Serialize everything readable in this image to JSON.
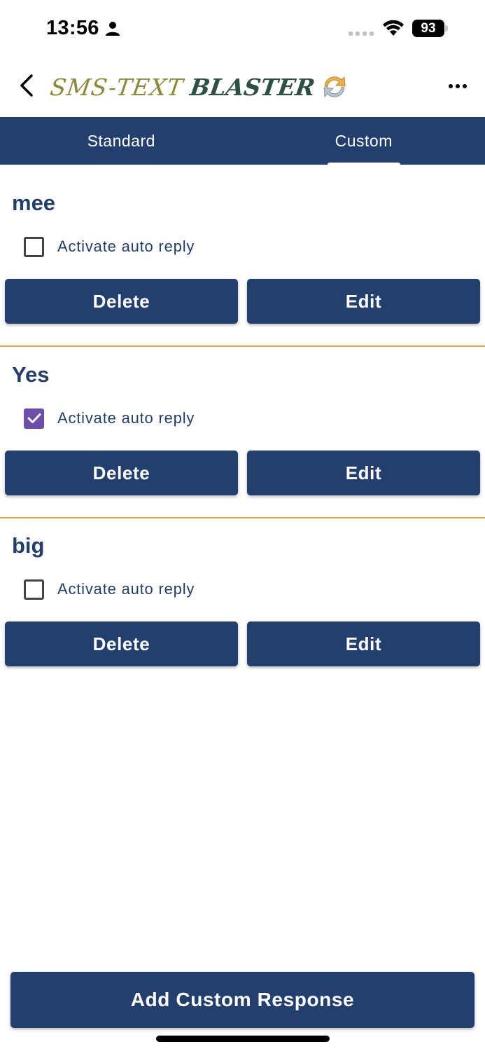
{
  "status_bar": {
    "time": "13:56",
    "battery": "93",
    "icons": [
      "person-icon",
      "signal-icon",
      "wifi-icon",
      "battery-icon"
    ]
  },
  "header": {
    "logo_part1": "SMS-TEXT",
    "logo_part2": "BLASTER",
    "icons": [
      "back-chevron-icon",
      "refresh-icon",
      "more-dots-icon"
    ]
  },
  "tabs": [
    {
      "label": "Standard",
      "selected": false
    },
    {
      "label": "Custom",
      "selected": true
    }
  ],
  "responses": [
    {
      "title": "mee",
      "checkbox_label": "Activate auto reply",
      "checked": false,
      "delete_label": "Delete",
      "edit_label": "Edit"
    },
    {
      "title": "Yes",
      "checkbox_label": "Activate auto reply",
      "checked": true,
      "delete_label": "Delete",
      "edit_label": "Edit"
    },
    {
      "title": "big",
      "checkbox_label": "Activate auto reply",
      "checked": false,
      "delete_label": "Delete",
      "edit_label": "Edit"
    }
  ],
  "add_button_label": "Add Custom Response",
  "colors": {
    "primary": "#233f6e",
    "divider": "#e8a54a",
    "checkbox_checked": "#6b4fa8"
  }
}
